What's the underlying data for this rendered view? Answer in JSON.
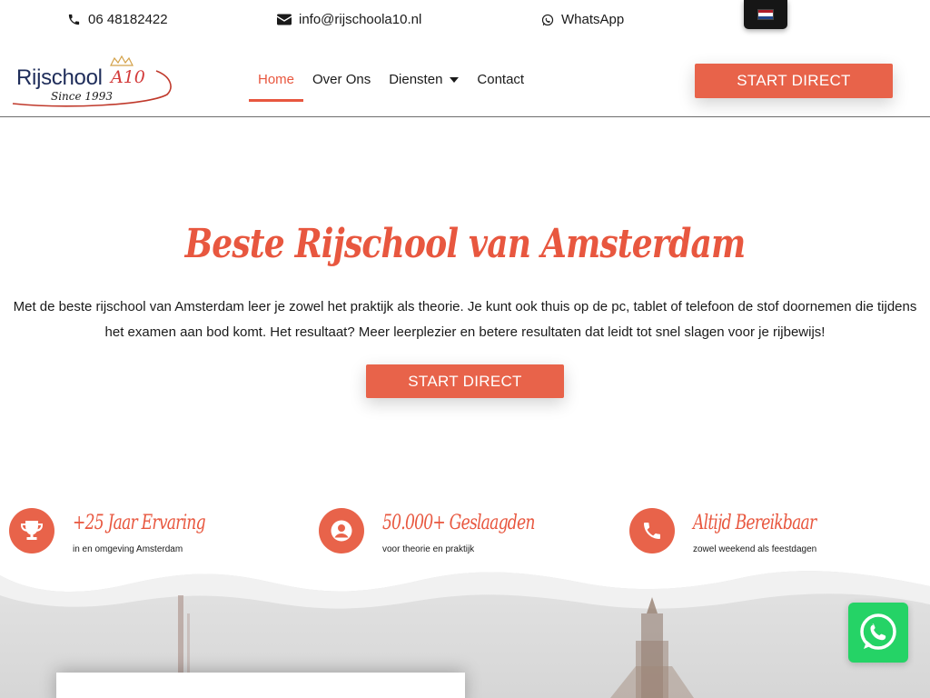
{
  "topbar": {
    "phone": "06 48182422",
    "email": "info@rijschoola10.nl",
    "whatsapp": "WhatsApp",
    "language_flag": "nl-flag"
  },
  "logo": {
    "name": "Rijschool",
    "suffix": "A10",
    "tagline": "Since 1993"
  },
  "nav": {
    "items": [
      {
        "label": "Home",
        "active": true
      },
      {
        "label": "Over Ons",
        "active": false
      },
      {
        "label": "Diensten",
        "active": false,
        "dropdown": true
      },
      {
        "label": "Contact",
        "active": false
      }
    ],
    "cta": "START DIRECT"
  },
  "hero": {
    "title": "Beste Rijschool van Amsterdam",
    "text": "Met de beste rijschool van Amsterdam leer je zowel het praktijk als theorie. Je kunt ook thuis op de pc, tablet of telefoon de stof doornemen die tijdens het examen aan bod komt. Het resultaat? Meer leerplezier en betere resultaten dat leidt tot snel slagen voor je rijbewijs!",
    "cta": "START DIRECT"
  },
  "features": [
    {
      "icon": "trophy-icon",
      "title": "+25 Jaar Ervaring",
      "subtitle": "in en omgeving Amsterdam"
    },
    {
      "icon": "user-circle-icon",
      "title": "50.000+ Geslaagden",
      "subtitle": "voor theorie en praktijk"
    },
    {
      "icon": "phone-icon",
      "title": "Altijd Bereikbaar",
      "subtitle": "zowel weekend als feestdagen"
    }
  ],
  "colors": {
    "accent": "#e8573f",
    "button": "#e8634a",
    "whatsapp": "#25d366",
    "logo_blue": "#1f2d5a"
  }
}
